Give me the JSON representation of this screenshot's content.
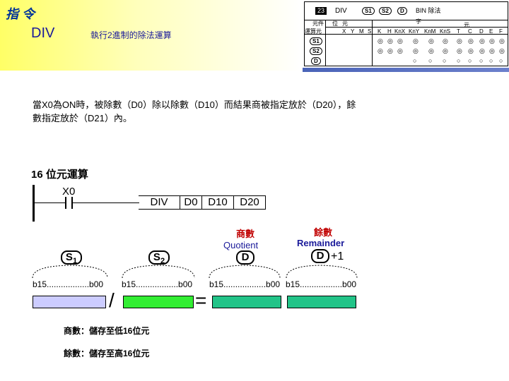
{
  "header": {
    "title": "指 令",
    "mnemonic": "DIV",
    "description": "執行2進制的除法運算"
  },
  "reference_table": {
    "step_no": "23",
    "mnemonic": "DIV",
    "operands": [
      "S1",
      "S2",
      "D"
    ],
    "function": "BIN 除法",
    "col_group_1": "元件",
    "col_group_2a": "位",
    "col_group_2b": "元",
    "col_group_3": "字",
    "col_group_3b": "元",
    "row_header": "運算元",
    "bit_columns": [
      "X",
      "Y",
      "M",
      "S"
    ],
    "word_columns": [
      "K",
      "H",
      "KnX",
      "KnY",
      "KnM",
      "KnS",
      "T",
      "C",
      "D",
      "E",
      "F"
    ],
    "rows": [
      {
        "name": "S1",
        "marks": [
          "◎",
          "◎",
          "◎",
          "◎",
          "◎",
          "◎",
          "◎",
          "◎",
          "◎",
          "◎",
          "◎"
        ]
      },
      {
        "name": "S2",
        "marks": [
          "◎",
          "◎",
          "◎",
          "◎",
          "◎",
          "◎",
          "◎",
          "◎",
          "◎",
          "◎",
          "◎"
        ]
      },
      {
        "name": "D",
        "marks": [
          "",
          "",
          "",
          "○",
          "○",
          "○",
          "○",
          "○",
          "○",
          "○",
          "○"
        ]
      }
    ]
  },
  "description": {
    "line1": "當X0為ON時，被除數（D0）除以除數（D10）而結果商被指定放於（D20），餘",
    "line2": "數指定放於（D21）內。"
  },
  "section_title": "16 位元運算",
  "ladder": {
    "contact": "X0",
    "instruction": [
      "DIV",
      "D0",
      "D10",
      "D20"
    ]
  },
  "diagram": {
    "op1": "S",
    "op1_sub": "1",
    "op2": "S",
    "op2_sub": "2",
    "quotient_zh": "商數",
    "quotient_en": "Quotient",
    "quotient_op": "D",
    "remainder_zh": "餘數",
    "remainder_en": "Remainder",
    "remainder_op": "D",
    "remainder_plus": "+1",
    "bits1": "b15..................b00",
    "bits2": "b15..................b00",
    "bits3": "b15..................b00",
    "bits4": "b15..................b00",
    "divide_sign": "/",
    "equals_sign": "=",
    "colors": {
      "s1": "#ccccff",
      "s2": "#33ee33",
      "quotient": "#22c488",
      "remainder": "#22c488"
    }
  },
  "notes": {
    "quotient": "商數：儲存至低16位元",
    "remainder": "餘數：儲存至高16位元"
  }
}
